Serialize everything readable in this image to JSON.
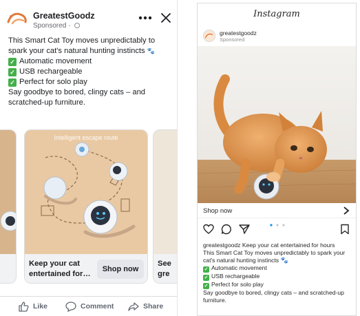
{
  "facebook": {
    "brand_name": "GreatestGoodz",
    "sponsored": "Sponsored",
    "body": {
      "intro_line1": "This Smart Cat Toy moves unpredictably to",
      "intro_line2": "spark your cat's natural hunting instincts",
      "features": [
        "Automatic movement",
        "USB rechargeable",
        "Perfect for solo play"
      ],
      "outro_line1": "Say goodbye to bored, clingy cats – and",
      "outro_line2": "scratched-up furniture."
    },
    "carousel": {
      "main_card": {
        "image_label": "Intelligent escape route",
        "caption_line1": "Keep your cat",
        "caption_line2": "entertained for…",
        "button": "Shop now"
      },
      "right_card": {
        "caption_line1": "See",
        "caption_line2": "gre"
      }
    },
    "actions": {
      "like": "Like",
      "comment": "Comment",
      "share": "Share"
    }
  },
  "instagram": {
    "logo": "Instagram",
    "username": "greatestgoodz",
    "sponsored": "Sponsored",
    "cta": "Shop now",
    "carousel_dots": {
      "count": 3,
      "active": 1
    },
    "caption": {
      "line1_user": "greatestgoodz",
      "line1_text": " Keep your cat entertained for hours",
      "line2": "This Smart Cat Toy moves unpredictably to spark your",
      "line3": "cat's natural hunting instincts",
      "features": [
        "Automatic movement",
        "USB rechargeable",
        "Perfect for solo play"
      ],
      "outro_line1": "Say goodbye to bored, clingy cats – and scratched-up",
      "outro_line2": "furniture."
    }
  },
  "colors": {
    "check_green": "#43b04a",
    "card_peach": "#e9c9a3",
    "cat_orange": "#d9893c"
  }
}
